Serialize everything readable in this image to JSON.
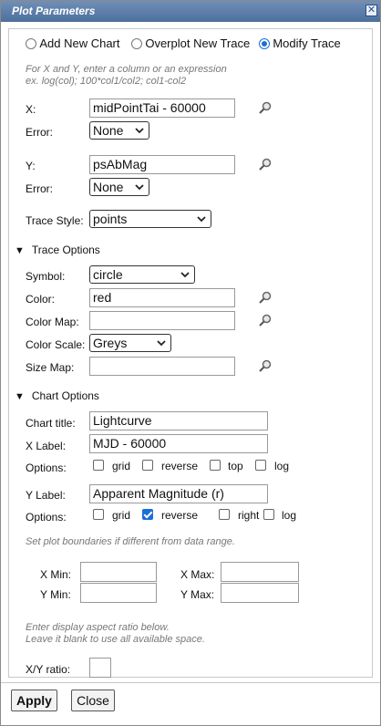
{
  "window": {
    "title": "Plot Parameters"
  },
  "modes": [
    {
      "label": "Add New Chart",
      "selected": false
    },
    {
      "label": "Overplot New Trace",
      "selected": false
    },
    {
      "label": "Modify Trace",
      "selected": true
    }
  ],
  "hint": {
    "line1": "For X and Y, enter a column or an expression",
    "line2": "ex. log(col); 100*col1/col2; col1-col2"
  },
  "x": {
    "label": "X:",
    "value": "midPointTai - 60000",
    "error_label": "Error:",
    "error_value": "None"
  },
  "y": {
    "label": "Y:",
    "value": "psAbMag",
    "error_label": "Error:",
    "error_value": "None"
  },
  "trace_style": {
    "label": "Trace Style:",
    "value": "points"
  },
  "trace_options": {
    "header": "Trace Options",
    "symbol_label": "Symbol:",
    "symbol_value": "circle",
    "color_label": "Color:",
    "color_value": "red",
    "colormap_label": "Color Map:",
    "colormap_value": "",
    "colorscale_label": "Color Scale:",
    "colorscale_value": "Greys",
    "sizemap_label": "Size Map:",
    "sizemap_value": ""
  },
  "chart_options": {
    "header": "Chart Options",
    "title_label": "Chart title:",
    "title_value": "Lightcurve",
    "xlabel_label": "X Label:",
    "xlabel_value": "MJD - 60000",
    "x_options_label": "Options:",
    "x_options": [
      {
        "label": "grid",
        "checked": false
      },
      {
        "label": "reverse",
        "checked": false
      },
      {
        "label": "top",
        "checked": false
      },
      {
        "label": "log",
        "checked": false
      }
    ],
    "ylabel_label": "Y Label:",
    "ylabel_value": "Apparent Magnitude (r)",
    "y_options_label": "Options:",
    "y_options": [
      {
        "label": "grid",
        "checked": false
      },
      {
        "label": "reverse",
        "checked": true
      },
      {
        "label": "right",
        "checked": false
      },
      {
        "label": "log",
        "checked": false
      }
    ],
    "bounds_hint": "Set plot boundaries if different from data range.",
    "xmin_label": "X Min:",
    "xmin_value": "",
    "xmax_label": "X Max:",
    "xmax_value": "",
    "ymin_label": "Y Min:",
    "ymin_value": "",
    "ymax_label": "Y Max:",
    "ymax_value": "",
    "aspect_hint1": "Enter display aspect ratio below.",
    "aspect_hint2": "Leave it blank to use all available space.",
    "ratio_label": "X/Y ratio:",
    "ratio_value": ""
  },
  "buttons": {
    "apply": "Apply",
    "close": "Close"
  },
  "colors": {
    "titlebar": "#5a7aa8",
    "accent": "#1a6fd8"
  }
}
